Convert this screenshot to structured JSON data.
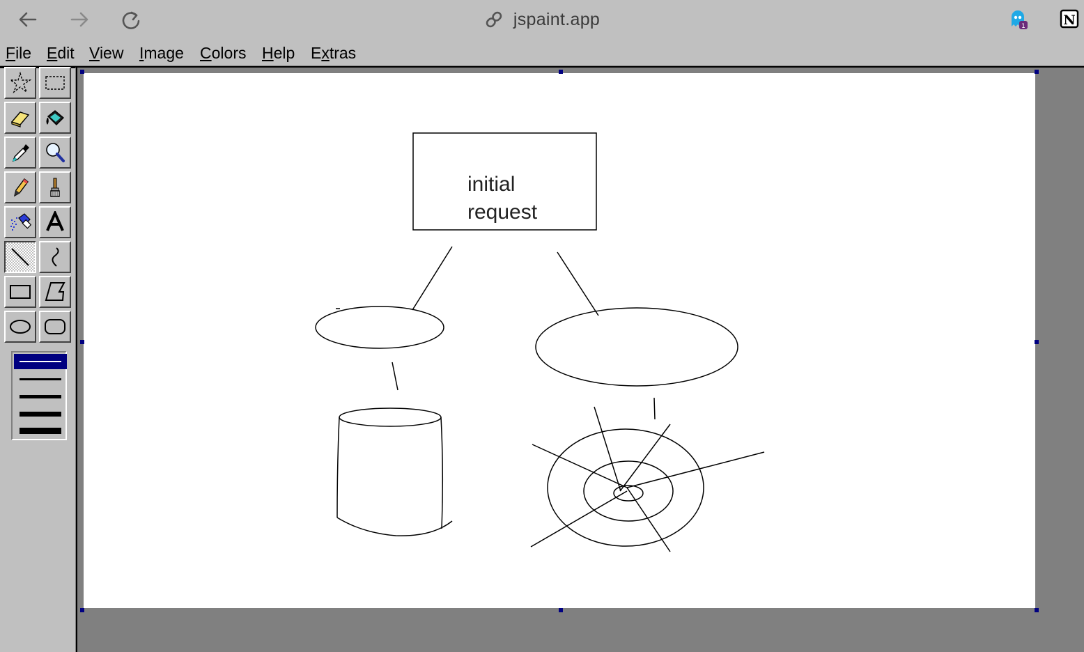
{
  "browser": {
    "url": "jspaint.app",
    "icons": [
      "back-arrow-icon",
      "forward-arrow-icon",
      "reload-icon",
      "link-icon",
      "ghost-extension-icon",
      "notion-icon"
    ],
    "ghost_badge": "1",
    "notion_letter": "N"
  },
  "menu": {
    "items": [
      {
        "label": "File",
        "accel": "F",
        "rest": "ile"
      },
      {
        "label": "Edit",
        "accel": "E",
        "rest": "dit"
      },
      {
        "label": "View",
        "accel": "V",
        "rest": "iew"
      },
      {
        "label": "Image",
        "accel": "I",
        "rest": "mage"
      },
      {
        "label": "Colors",
        "accel": "C",
        "rest": "olors"
      },
      {
        "label": "Help",
        "accel": "H",
        "rest": "elp"
      },
      {
        "label": "Extras",
        "pre": "E",
        "accel": "x",
        "rest": "tras"
      }
    ]
  },
  "toolbox": {
    "tools": [
      "free-form-select",
      "rectangle-select",
      "eraser",
      "fill-with-color",
      "pick-color",
      "magnifier",
      "pencil",
      "brush",
      "airbrush",
      "text",
      "line",
      "curve",
      "rectangle",
      "polygon",
      "ellipse",
      "rounded-rectangle"
    ],
    "selected_tool": "line",
    "line_widths": [
      1,
      2,
      3,
      4,
      5
    ],
    "selected_line_width": 1
  },
  "canvas": {
    "text": {
      "line1": "initial",
      "line2": "request"
    }
  }
}
